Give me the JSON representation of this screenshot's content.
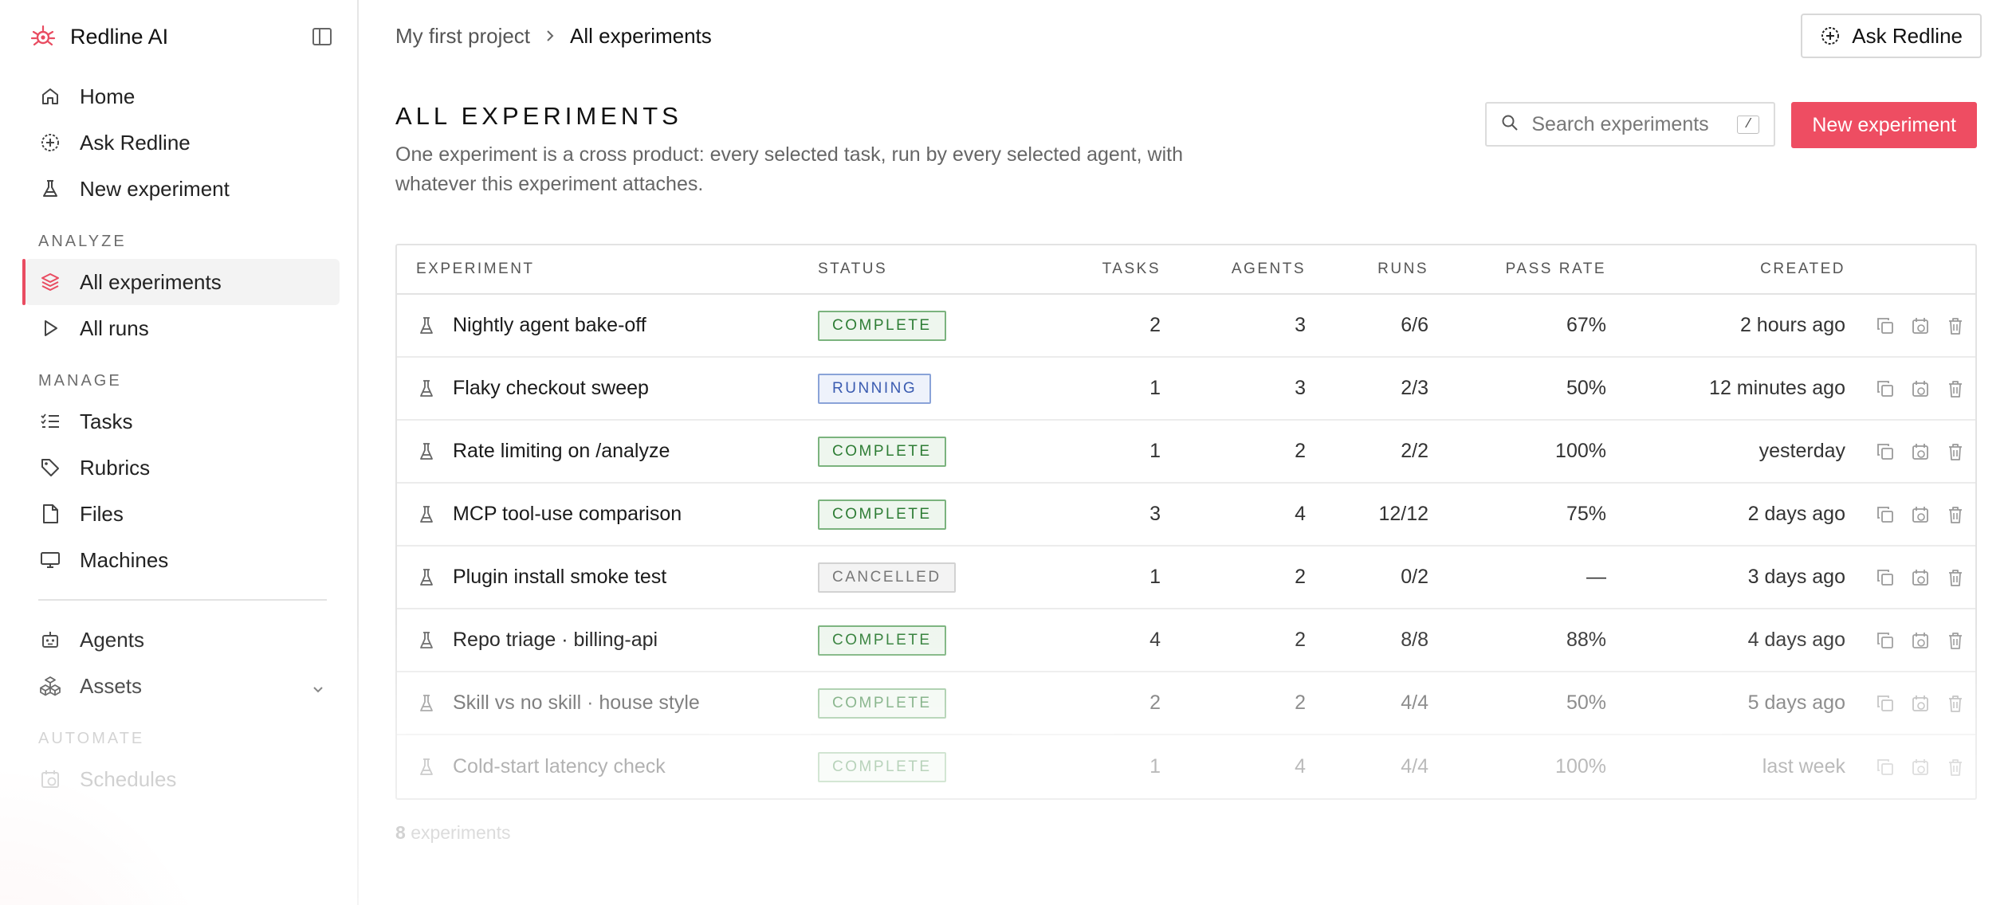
{
  "brand": {
    "name": "Redline AI",
    "accent": "#e94c61"
  },
  "sidebar": {
    "primary": [
      {
        "label": "Home",
        "icon": "home-icon"
      },
      {
        "label": "Ask Redline",
        "icon": "ask-icon"
      },
      {
        "label": "New experiment",
        "icon": "flask-icon"
      }
    ],
    "analyze_label": "ANALYZE",
    "analyze": [
      {
        "label": "All experiments",
        "icon": "layers-icon",
        "active": true
      },
      {
        "label": "All runs",
        "icon": "play-icon"
      }
    ],
    "manage_label": "MANAGE",
    "manage": [
      {
        "label": "Tasks",
        "icon": "checklist-icon"
      },
      {
        "label": "Rubrics",
        "icon": "tag-icon"
      },
      {
        "label": "Files",
        "icon": "file-icon"
      },
      {
        "label": "Machines",
        "icon": "monitor-icon"
      }
    ],
    "extra": [
      {
        "label": "Agents",
        "icon": "robot-icon"
      },
      {
        "label": "Assets",
        "icon": "assets-icon"
      }
    ],
    "automate_label": "AUTOMATE",
    "automate": [
      {
        "label": "Schedules",
        "icon": "calendar-clock-icon"
      }
    ]
  },
  "breadcrumb": {
    "parent": "My first project",
    "current": "All experiments"
  },
  "ask_button": "Ask Redline",
  "header": {
    "title": "ALL EXPERIMENTS",
    "description": "One experiment is a cross product: every selected task, run by every selected agent, with whatever this experiment attaches."
  },
  "search": {
    "placeholder": "Search experiments",
    "shortcut": "/"
  },
  "new_button": "New experiment",
  "table": {
    "columns": {
      "experiment": "EXPERIMENT",
      "status": "STATUS",
      "tasks": "TASKS",
      "agents": "AGENTS",
      "runs": "RUNS",
      "pass_rate": "PASS RATE",
      "created": "CREATED"
    },
    "rows": [
      {
        "name": "Nightly agent bake-off",
        "status": "COMPLETE",
        "tasks": "2",
        "agents": "3",
        "runs": "6/6",
        "pass_rate": "67%",
        "created": "2 hours ago"
      },
      {
        "name": "Flaky checkout sweep",
        "status": "RUNNING",
        "tasks": "1",
        "agents": "3",
        "runs": "2/3",
        "pass_rate": "50%",
        "created": "12 minutes ago"
      },
      {
        "name": "Rate limiting on /analyze",
        "status": "COMPLETE",
        "tasks": "1",
        "agents": "2",
        "runs": "2/2",
        "pass_rate": "100%",
        "created": "yesterday"
      },
      {
        "name": "MCP tool-use comparison",
        "status": "COMPLETE",
        "tasks": "3",
        "agents": "4",
        "runs": "12/12",
        "pass_rate": "75%",
        "created": "2 days ago"
      },
      {
        "name": "Plugin install smoke test",
        "status": "CANCELLED",
        "tasks": "1",
        "agents": "2",
        "runs": "0/2",
        "pass_rate": "—",
        "created": "3 days ago"
      },
      {
        "name": "Repo triage · billing-api",
        "status": "COMPLETE",
        "tasks": "4",
        "agents": "2",
        "runs": "8/8",
        "pass_rate": "88%",
        "created": "4 days ago"
      },
      {
        "name": "Skill vs no skill · house style",
        "status": "COMPLETE",
        "tasks": "2",
        "agents": "2",
        "runs": "4/4",
        "pass_rate": "50%",
        "created": "5 days ago"
      },
      {
        "name": "Cold-start latency check",
        "status": "COMPLETE",
        "tasks": "1",
        "agents": "4",
        "runs": "4/4",
        "pass_rate": "100%",
        "created": "last week"
      }
    ]
  },
  "footer": {
    "count": "8",
    "label": "experiments"
  },
  "colors": {
    "complete": "#2e7d35",
    "running": "#3a5bb0",
    "cancelled": "#777777",
    "primary_button": "#ee4d62"
  }
}
